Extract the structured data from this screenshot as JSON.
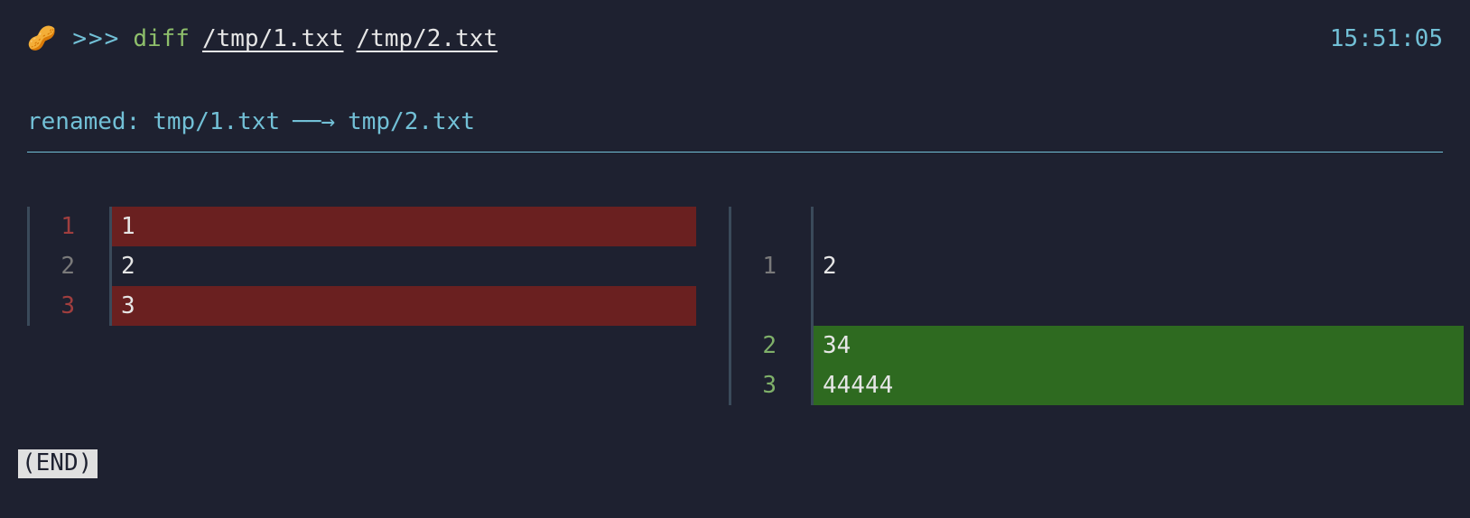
{
  "prompt": {
    "icon": "🥜",
    "arrows": ">>>",
    "command": "diff",
    "arg1": "/tmp/1.txt",
    "arg2": "/tmp/2.txt"
  },
  "timestamp": "15:51:05",
  "renamed": {
    "label": "renamed:",
    "from": "tmp/1.txt",
    "arrow": "──→",
    "to": "tmp/2.txt"
  },
  "diff": {
    "left": [
      {
        "num": "1",
        "text": "1",
        "kind": "removed"
      },
      {
        "num": "2",
        "text": "2",
        "kind": "unchanged"
      },
      {
        "num": "3",
        "text": "3",
        "kind": "removed"
      }
    ],
    "right": [
      {
        "num": "",
        "text": "",
        "kind": "empty"
      },
      {
        "num": "1",
        "text": "2",
        "kind": "unchanged"
      },
      {
        "num": "",
        "text": "",
        "kind": "empty"
      },
      {
        "num": "2",
        "text": "34",
        "kind": "added"
      },
      {
        "num": "3",
        "text": "44444",
        "kind": "added"
      }
    ]
  },
  "pager_end": "(END)"
}
